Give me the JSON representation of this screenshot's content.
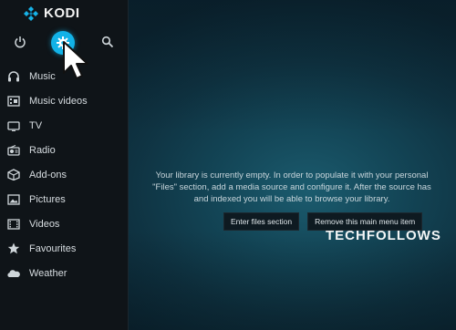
{
  "app": {
    "name": "KODI"
  },
  "top_bar": {
    "icons": [
      "power-icon",
      "settings-icon",
      "search-icon"
    ]
  },
  "menu": {
    "items": [
      {
        "label": "Music",
        "icon": "headphones-icon"
      },
      {
        "label": "Music videos",
        "icon": "music-video-icon"
      },
      {
        "label": "TV",
        "icon": "tv-icon"
      },
      {
        "label": "Radio",
        "icon": "radio-icon"
      },
      {
        "label": "Add-ons",
        "icon": "addon-box-icon"
      },
      {
        "label": "Pictures",
        "icon": "pictures-icon"
      },
      {
        "label": "Videos",
        "icon": "video-icon"
      },
      {
        "label": "Favourites",
        "icon": "star-icon"
      },
      {
        "label": "Weather",
        "icon": "weather-icon"
      }
    ]
  },
  "main": {
    "message_lines": [
      "Your library is currently empty. In order to populate it with your personal",
      "\"Files\" section, add a media source and configure it. After the source has",
      "and indexed you will be able to browse your library."
    ],
    "buttons": {
      "enter_files": "Enter files section",
      "remove_item": "Remove this main menu item"
    }
  },
  "watermark": "TECHFOLLOWS",
  "colors": {
    "accent": "#12b2e7",
    "sidebar_bg": "#0f1418",
    "main_bg": "#134556"
  }
}
